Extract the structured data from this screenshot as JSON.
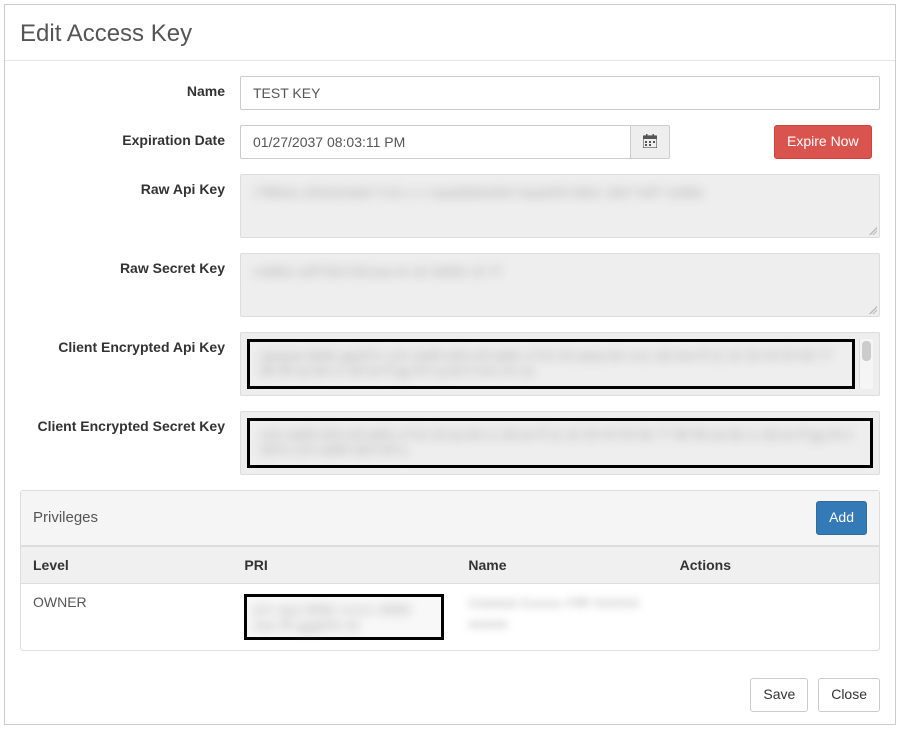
{
  "modal": {
    "title": "Edit Access Key"
  },
  "form": {
    "name": {
      "label": "Name",
      "value": "TEST KEY"
    },
    "expiration": {
      "label": "Expiration Date",
      "value": "01/27/2037 08:03:11 PM",
      "expire_now": "Expire Now"
    },
    "raw_api": {
      "label": "Raw Api Key",
      "value": ""
    },
    "raw_secret": {
      "label": "Raw Secret Key",
      "value": ""
    },
    "enc_api": {
      "label": "Client Encrypted Api Key",
      "value": ""
    },
    "enc_secret": {
      "label": "Client Encrypted Secret Key",
      "value": ""
    }
  },
  "privileges": {
    "title": "Privileges",
    "add_label": "Add",
    "columns": {
      "level": "Level",
      "pri": "PRI",
      "name": "Name",
      "actions": "Actions"
    },
    "rows": [
      {
        "level": "OWNER",
        "pri": "",
        "name": "",
        "actions": ""
      }
    ]
  },
  "footer": {
    "save": "Save",
    "close": "Close"
  }
}
